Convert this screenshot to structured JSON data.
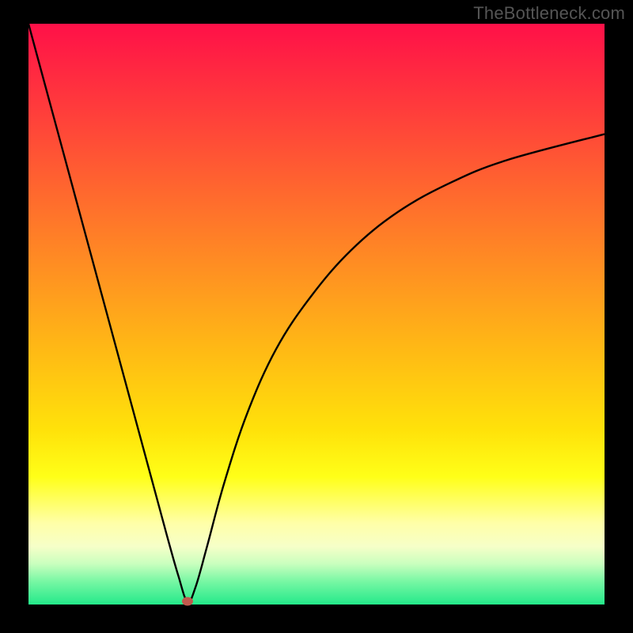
{
  "watermark": "TheBottleneck.com",
  "colors": {
    "frame_bg": "#000000",
    "curve_stroke": "#000000",
    "marker_fill": "#c1594d"
  },
  "gradient_stops": [
    {
      "pct": 0,
      "color": "#ff1048"
    },
    {
      "pct": 14,
      "color": "#ff3a3c"
    },
    {
      "pct": 28,
      "color": "#ff652f"
    },
    {
      "pct": 42,
      "color": "#ff8f22"
    },
    {
      "pct": 56,
      "color": "#ffb915"
    },
    {
      "pct": 70,
      "color": "#ffe20a"
    },
    {
      "pct": 78,
      "color": "#ffff18"
    },
    {
      "pct": 82,
      "color": "#ffff60"
    },
    {
      "pct": 86,
      "color": "#ffffa8"
    },
    {
      "pct": 90,
      "color": "#f6ffc8"
    },
    {
      "pct": 93,
      "color": "#c9ffbe"
    },
    {
      "pct": 96,
      "color": "#78f7a4"
    },
    {
      "pct": 100,
      "color": "#24e98a"
    }
  ],
  "chart_data": {
    "type": "line",
    "title": "",
    "xlabel": "",
    "ylabel": "",
    "xlim": [
      0,
      100
    ],
    "ylim": [
      0,
      100
    ],
    "grid": false,
    "legend": false,
    "series": [
      {
        "name": "bottleneck-curve",
        "x": [
          0,
          3,
          6,
          9,
          12,
          15,
          18,
          21,
          24,
          26,
          27.6,
          29,
          31,
          34,
          38,
          43,
          49,
          56,
          64,
          73,
          83,
          100
        ],
        "y": [
          100,
          89,
          78,
          67,
          56,
          45,
          34,
          23,
          12,
          5,
          0.5,
          3,
          10,
          21,
          33,
          44,
          53,
          61,
          67.5,
          72.5,
          76.5,
          81
        ]
      }
    ],
    "marker": {
      "x": 27.6,
      "y": 0.5
    }
  }
}
